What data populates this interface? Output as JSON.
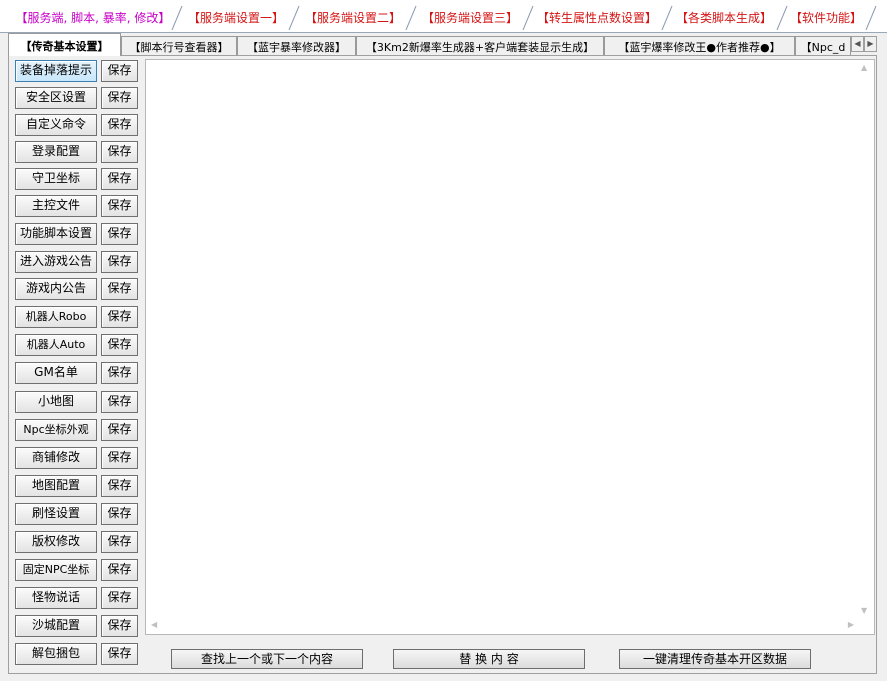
{
  "top_tabs": [
    "【服务端, 脚本, 暴率, 修改】",
    "【服务端设置一】",
    "【服务端设置二】",
    "【服务端设置三】",
    "【转生属性点数设置】",
    "【各类脚本生成】",
    "【软件功能】"
  ],
  "inner_tabs": [
    "【传奇基本设置】",
    "【脚本行号查看器】",
    "【蓝宇暴率修改器】",
    "【3Km2新爆率生成器+客户端套装显示生成】",
    "【蓝宇爆率修改王●作者推荐●】",
    "【Npc_d"
  ],
  "left_buttons": [
    "装备掉落提示",
    "安全区设置",
    "自定义命令",
    "登录配置",
    "守卫坐标",
    "主控文件",
    "功能脚本设置",
    "进入游戏公告",
    "游戏内公告",
    "机器人Robo",
    "机器人Auto",
    "GM名单",
    "小地图",
    "Npc坐标外观",
    "商铺修改",
    "地图配置",
    "刷怪设置",
    "版权修改",
    "固定NPC坐标",
    "怪物说话",
    "沙城配置",
    "解包捆包"
  ],
  "save_label": "保存",
  "bottom_buttons": {
    "find": "查找上一个或下一个内容",
    "replace": "替 换 内 容",
    "clear": "一键清理传奇基本开区数据"
  },
  "editor_text": ""
}
